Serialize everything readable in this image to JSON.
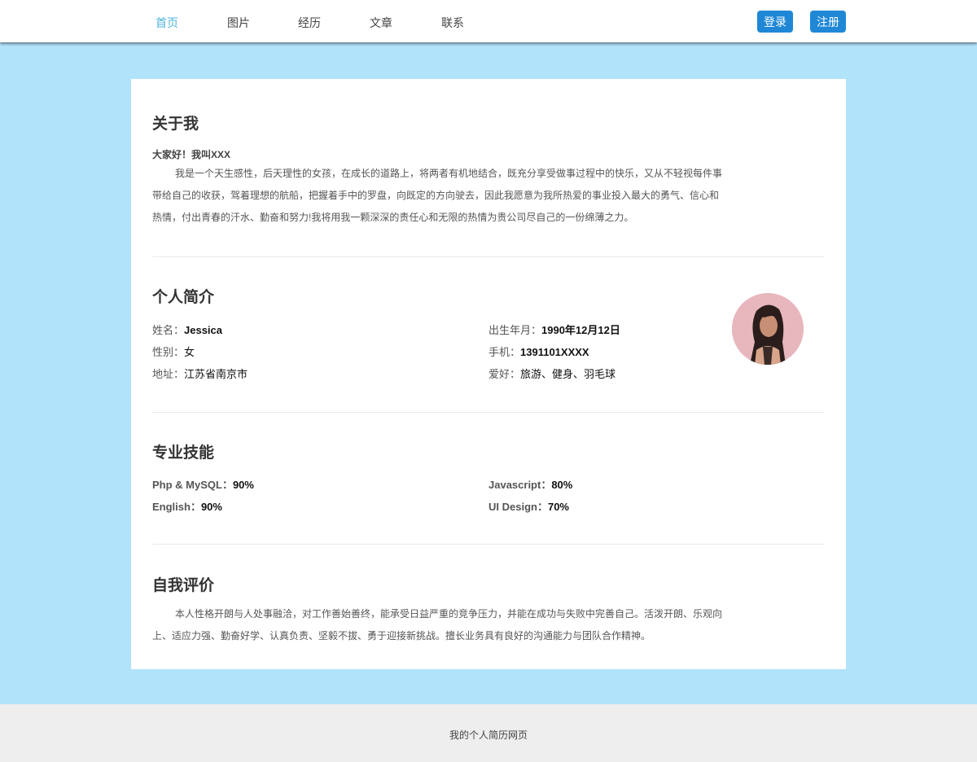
{
  "nav": {
    "items": [
      {
        "label": "首页"
      },
      {
        "label": "图片"
      },
      {
        "label": "经历"
      },
      {
        "label": "文章"
      },
      {
        "label": "联系"
      }
    ],
    "active_index": 0,
    "login_label": "登录",
    "register_label": "注册"
  },
  "about": {
    "title": "关于我",
    "greeting": "大家好！我叫XXX",
    "paragraph": "我是一个天生感性，后天理性的女孩，在成长的道路上，将两者有机地结合，既充分享受做事过程中的快乐，又从不轻视每件事带给自己的收获，驾着理想的航船，把握着手中的罗盘，向既定的方向驶去，因此我愿意为我所热爱的事业投入最大的勇气、信心和热情，付出青春的汗水、勤奋和努力!我将用我一颗深深的责任心和无限的热情为贵公司尽自己的一份绵薄之力。"
  },
  "profile": {
    "title": "个人简介",
    "name_label": "姓名：",
    "name_value": "Jessica",
    "gender_label": "性别：",
    "gender_value": "女",
    "address_label": "地址：",
    "address_value": "江苏省南京市",
    "birth_label": "出生年月：",
    "birth_value": "1990年12月12日",
    "phone_label": "手机：",
    "phone_value": "1391101XXXX",
    "hobby_label": "爱好：",
    "hobby_value": "旅游、健身、羽毛球"
  },
  "skills": {
    "title": "专业技能",
    "items": [
      {
        "label": "Php & MySQL：",
        "value": "90%"
      },
      {
        "label": "Javascript：",
        "value": "80%"
      },
      {
        "label": "English：",
        "value": "90%"
      },
      {
        "label": "UI Design：",
        "value": "70%"
      }
    ]
  },
  "self_eval": {
    "title": "自我评价",
    "paragraph": "本人性格开朗与人处事融洽，对工作善始善终，能承受日益严重的竞争压力，并能在成功与失败中完善自己。活泼开朗、乐观向上、适应力强、勤奋好学、认真负责、坚毅不拔、勇于迎接新挑战。擅长业务具有良好的沟通能力与团队合作精神。"
  },
  "footer": {
    "text": "我的个人简历网页"
  },
  "colors": {
    "background": "#b1e3fb",
    "active_nav": "#4fb3d9",
    "button": "#1f87d6",
    "footer": "#eeeeee"
  }
}
